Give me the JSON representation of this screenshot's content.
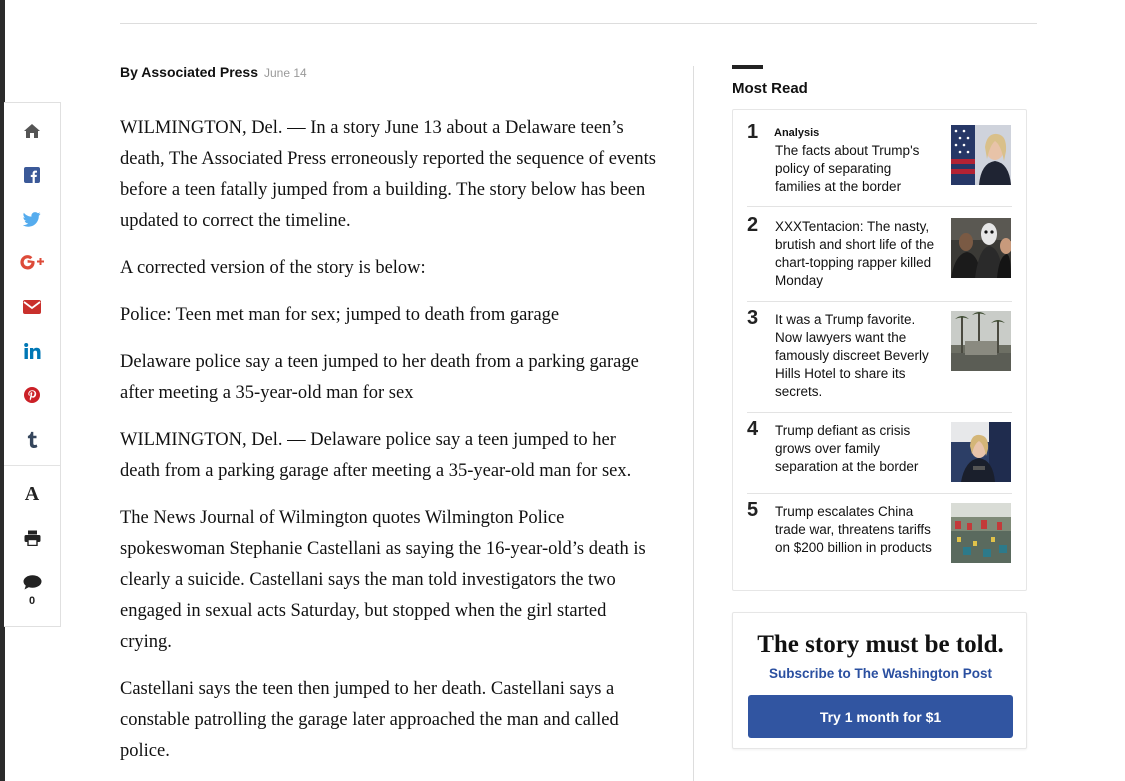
{
  "byline": {
    "author": "By Associated Press",
    "date": "June 14"
  },
  "share": {
    "icons": [
      "home-icon",
      "facebook-icon",
      "twitter-icon",
      "google-plus-icon",
      "email-icon",
      "linkedin-icon",
      "pinterest-icon",
      "tumblr-icon",
      "font-size-icon",
      "print-icon",
      "comment-icon"
    ],
    "font_label": "A",
    "comment_count": "0",
    "colors": {
      "home": "#555555",
      "facebook": "#3b5998",
      "twitter": "#55acee",
      "google_plus": "#dd4b39",
      "email": "#c9302c",
      "linkedin": "#0077b5",
      "pinterest": "#cb2027",
      "tumblr": "#35465c"
    }
  },
  "article": {
    "paragraphs": [
      "WILMINGTON, Del. — In a story June 13 about a Delaware teen’s death, The Associated Press erroneously reported the sequence of events before a teen fatally jumped from a building. The story below has been updated to correct the timeline.",
      "A corrected version of the story is below:",
      "Police: Teen met man for sex; jumped to death from garage",
      "Delaware police say a teen jumped to her death from a parking garage after meeting a 35-year-old man for sex",
      "WILMINGTON, Del. — Delaware police say a teen jumped to her death from a parking garage after meeting a 35-year-old man for sex.",
      "The News Journal of Wilmington quotes Wilmington Police spokeswoman Stephanie Castellani as saying the 16-year-old’s death is clearly a suicide. Castellani says the man told investigators the two engaged in sexual acts Saturday, but stopped when the girl started crying.",
      "Castellani says the teen then jumped to her death. Castellani says a constable patrolling the garage later approached the man and called police."
    ]
  },
  "most_read": {
    "title": "Most Read",
    "items": [
      {
        "num": "1",
        "kicker": "Analysis",
        "headline": "The facts about Trump's policy of separating families at the border"
      },
      {
        "num": "2",
        "kicker": "",
        "headline": "XXXTentacion: The nasty, brutish and short life of the chart-topping rapper killed Monday"
      },
      {
        "num": "3",
        "kicker": "",
        "headline": "It was a Trump favorite. Now lawyers want the famously discreet Beverly Hills Hotel to share its secrets."
      },
      {
        "num": "4",
        "kicker": "",
        "headline": "Trump defiant as crisis grows over family separation at the border"
      },
      {
        "num": "5",
        "kicker": "",
        "headline": "Trump escalates China trade war, threatens tariffs on $200 billion in products"
      }
    ]
  },
  "subscribe": {
    "headline": "The story must be told.",
    "link": "Subscribe to The Washington Post",
    "button": "Try 1 month for $1",
    "button_color": "#3155a1"
  }
}
